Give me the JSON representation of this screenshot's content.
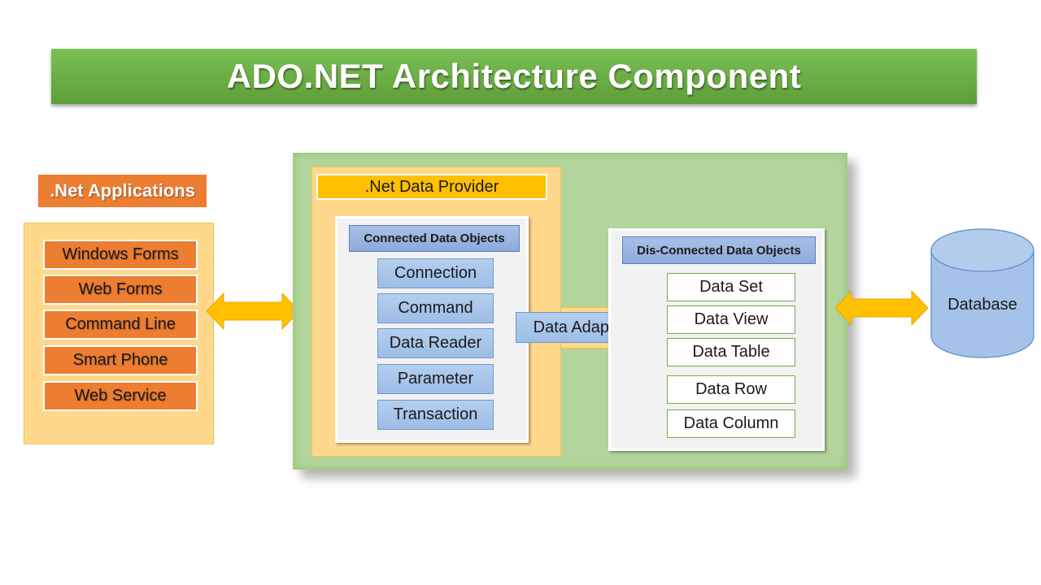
{
  "title": "ADO.NET Architecture Component",
  "applications": {
    "label": ".Net Applications",
    "items": [
      "Windows Forms",
      "Web Forms",
      "Command Line",
      "Smart Phone",
      "Web Service"
    ]
  },
  "provider": {
    "label": ".Net Data Provider",
    "connected": {
      "label": "Connected Data Objects",
      "items": [
        "Connection",
        "Command",
        "Data Reader",
        "Parameter",
        "Transaction"
      ]
    },
    "adapter": "Data Adapter"
  },
  "disconnected": {
    "label": "Dis-Connected Data Objects",
    "items": [
      "Data Set",
      "Data View",
      "Data Table",
      "Data Row",
      "Data Column"
    ]
  },
  "database": {
    "label": "Database"
  },
  "colors": {
    "title_green": "#6aaa45",
    "orange": "#ed7d31",
    "light_orange": "#ffd88c",
    "gold": "#ffc000",
    "green_panel": "#b3d59c",
    "blue": "#9dbde6"
  }
}
